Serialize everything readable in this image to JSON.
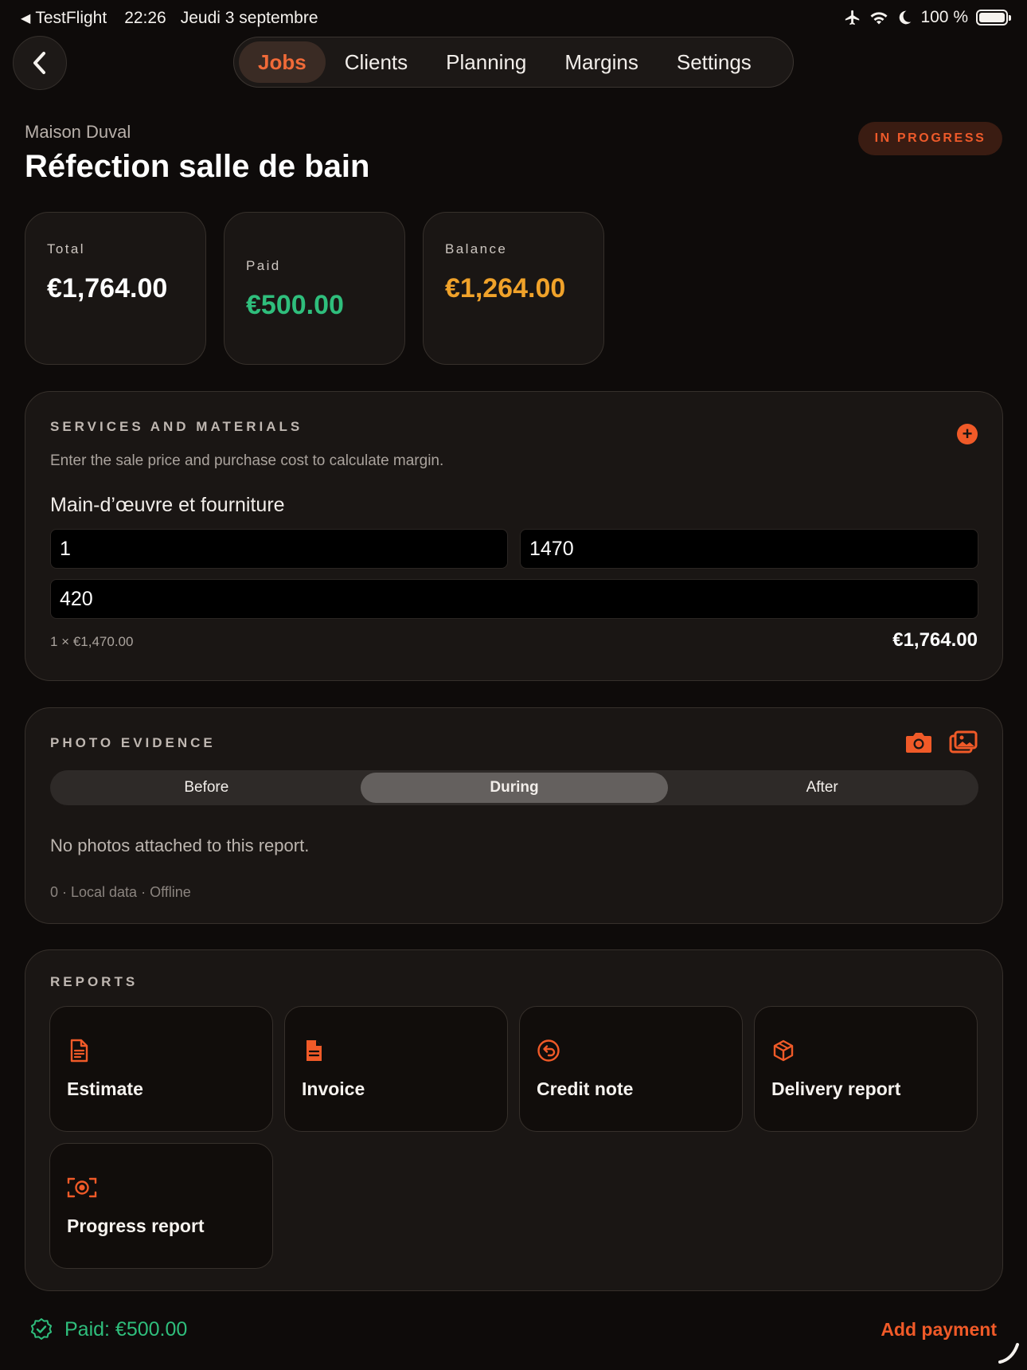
{
  "status_bar": {
    "app": "TestFlight",
    "time": "22:26",
    "date": "Jeudi 3 septembre",
    "battery": "100 %"
  },
  "nav": {
    "tabs": [
      {
        "label": "Jobs",
        "active": true
      },
      {
        "label": "Clients",
        "active": false
      },
      {
        "label": "Planning",
        "active": false
      },
      {
        "label": "Margins",
        "active": false
      },
      {
        "label": "Settings",
        "active": false
      }
    ]
  },
  "header": {
    "client": "Maison Duval",
    "title": "Réfection salle de bain",
    "status": "IN PROGRESS"
  },
  "stats": {
    "total_label": "Total",
    "total_value": "€1,764.00",
    "paid_label": "Paid",
    "paid_value": "€500.00",
    "balance_label": "Balance",
    "balance_value": "€1,264.00"
  },
  "services": {
    "title": "SERVICES AND MATERIALS",
    "hint": "Enter the sale price and purchase cost to calculate margin.",
    "item_name": "Main-d’œuvre et fourniture",
    "quantity": "1",
    "sale_price": "1470",
    "purchase_cost": "420",
    "line_calc": "1 × €1,470.00",
    "line_total": "€1,764.00"
  },
  "photos": {
    "title": "PHOTO EVIDENCE",
    "segments": [
      {
        "label": "Before",
        "active": false
      },
      {
        "label": "During",
        "active": true
      },
      {
        "label": "After",
        "active": false
      }
    ],
    "empty": "No photos attached to this report.",
    "meta": "0 · Local data · Offline"
  },
  "reports": {
    "title": "REPORTS",
    "items": [
      {
        "label": "Estimate",
        "icon": "document-lines-icon"
      },
      {
        "label": "Invoice",
        "icon": "invoice-icon"
      },
      {
        "label": "Credit note",
        "icon": "undo-circle-icon"
      },
      {
        "label": "Delivery report",
        "icon": "package-icon"
      },
      {
        "label": "Progress report",
        "icon": "target-scan-icon"
      }
    ]
  },
  "footer": {
    "paid_summary": "Paid: €500.00",
    "add_payment": "Add payment"
  },
  "colors": {
    "accent": "#f05a28",
    "paid_green": "#2fbe7c",
    "balance_amber": "#f0a22a",
    "background": "#0e0b0a",
    "card": "#1a1614"
  }
}
